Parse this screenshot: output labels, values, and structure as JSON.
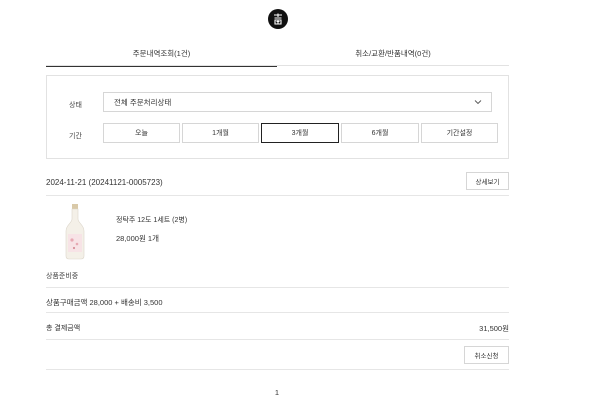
{
  "brand": {
    "logo_icon": "brand-seal-icon"
  },
  "tabs": [
    {
      "label": "주문내역조회(1건)",
      "active": true
    },
    {
      "label": "취소/교환/반품내역(0건)",
      "active": false
    }
  ],
  "filter": {
    "status_label": "상태",
    "status_value": "전체 주문처리상태",
    "period_label": "기간",
    "period_options": [
      "오늘",
      "1개월",
      "3개월",
      "6개월",
      "기간설정"
    ],
    "period_selected": "3개월"
  },
  "order": {
    "date_id": "2024-11-21 (20241121-0005723)",
    "detail_button": "상세보기",
    "product": {
      "name": "정탁주 12도 1세트 (2병)",
      "price_qty": "28,000원 1개"
    },
    "status": "상품준비중",
    "summary": "상품구매금액 28,000 + 배송비 3,500",
    "total_label": "총 결제금액",
    "total_value": "31,500원",
    "cancel_button": "취소신청"
  },
  "pagination": {
    "current": "1"
  },
  "colors": {
    "text": "#222222",
    "border": "#d6d6d6",
    "divider": "#e6e6e6",
    "accent": "#111111"
  }
}
